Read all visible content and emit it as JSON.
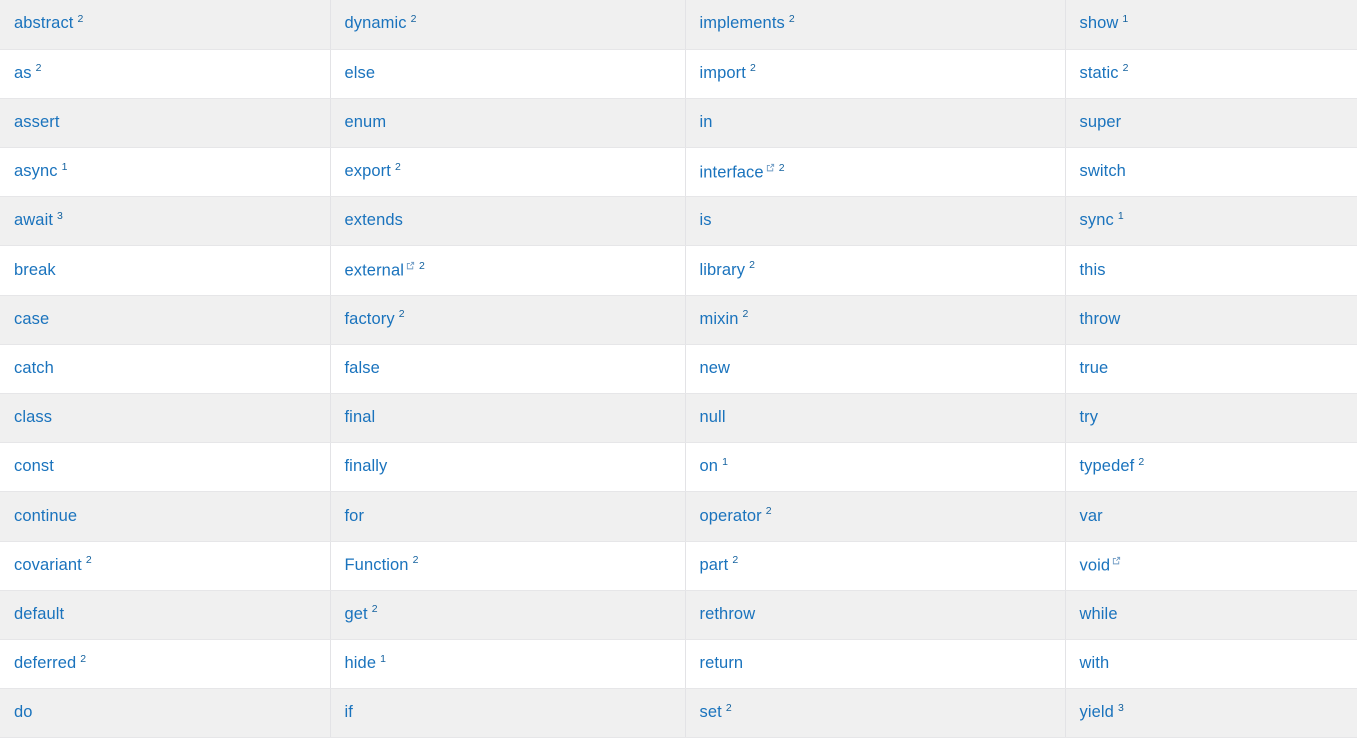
{
  "page": {
    "title": "Dart language keywords",
    "link_color": "#1a73bd",
    "footnote_color": "#14629f",
    "row_stripe_color": "#f0f0f0",
    "row_base_color": "#ffffff",
    "border_color": "#e3e3e6"
  },
  "table": {
    "column_count": 4,
    "row_count": 15,
    "rows": [
      [
        {
          "label": "abstract",
          "footnote": "2",
          "external": false
        },
        {
          "label": "dynamic",
          "footnote": "2",
          "external": false
        },
        {
          "label": "implements",
          "footnote": "2",
          "external": false
        },
        {
          "label": "show",
          "footnote": "1",
          "external": false
        }
      ],
      [
        {
          "label": "as",
          "footnote": "2",
          "external": false
        },
        {
          "label": "else",
          "footnote": "",
          "external": false
        },
        {
          "label": "import",
          "footnote": "2",
          "external": false
        },
        {
          "label": "static",
          "footnote": "2",
          "external": false
        }
      ],
      [
        {
          "label": "assert",
          "footnote": "",
          "external": false
        },
        {
          "label": "enum",
          "footnote": "",
          "external": false
        },
        {
          "label": "in",
          "footnote": "",
          "external": false
        },
        {
          "label": "super",
          "footnote": "",
          "external": false
        }
      ],
      [
        {
          "label": "async",
          "footnote": "1",
          "external": false
        },
        {
          "label": "export",
          "footnote": "2",
          "external": false
        },
        {
          "label": "interface",
          "footnote": "2",
          "external": true
        },
        {
          "label": "switch",
          "footnote": "",
          "external": false
        }
      ],
      [
        {
          "label": "await",
          "footnote": "3",
          "external": false
        },
        {
          "label": "extends",
          "footnote": "",
          "external": false
        },
        {
          "label": "is",
          "footnote": "",
          "external": false
        },
        {
          "label": "sync",
          "footnote": "1",
          "external": false
        }
      ],
      [
        {
          "label": "break",
          "footnote": "",
          "external": false
        },
        {
          "label": "external",
          "footnote": "2",
          "external": true
        },
        {
          "label": "library",
          "footnote": "2",
          "external": false
        },
        {
          "label": "this",
          "footnote": "",
          "external": false
        }
      ],
      [
        {
          "label": "case",
          "footnote": "",
          "external": false
        },
        {
          "label": "factory",
          "footnote": "2",
          "external": false
        },
        {
          "label": "mixin",
          "footnote": "2",
          "external": false
        },
        {
          "label": "throw",
          "footnote": "",
          "external": false
        }
      ],
      [
        {
          "label": "catch",
          "footnote": "",
          "external": false
        },
        {
          "label": "false",
          "footnote": "",
          "external": false
        },
        {
          "label": "new",
          "footnote": "",
          "external": false
        },
        {
          "label": "true",
          "footnote": "",
          "external": false
        }
      ],
      [
        {
          "label": "class",
          "footnote": "",
          "external": false
        },
        {
          "label": "final",
          "footnote": "",
          "external": false
        },
        {
          "label": "null",
          "footnote": "",
          "external": false
        },
        {
          "label": "try",
          "footnote": "",
          "external": false
        }
      ],
      [
        {
          "label": "const",
          "footnote": "",
          "external": false
        },
        {
          "label": "finally",
          "footnote": "",
          "external": false
        },
        {
          "label": "on",
          "footnote": "1",
          "external": false
        },
        {
          "label": "typedef",
          "footnote": "2",
          "external": false
        }
      ],
      [
        {
          "label": "continue",
          "footnote": "",
          "external": false
        },
        {
          "label": "for",
          "footnote": "",
          "external": false
        },
        {
          "label": "operator",
          "footnote": "2",
          "external": false
        },
        {
          "label": "var",
          "footnote": "",
          "external": false
        }
      ],
      [
        {
          "label": "covariant",
          "footnote": "2",
          "external": false
        },
        {
          "label": "Function",
          "footnote": "2",
          "external": false
        },
        {
          "label": "part",
          "footnote": "2",
          "external": false
        },
        {
          "label": "void",
          "footnote": "",
          "external": true
        }
      ],
      [
        {
          "label": "default",
          "footnote": "",
          "external": false
        },
        {
          "label": "get",
          "footnote": "2",
          "external": false
        },
        {
          "label": "rethrow",
          "footnote": "",
          "external": false
        },
        {
          "label": "while",
          "footnote": "",
          "external": false
        }
      ],
      [
        {
          "label": "deferred",
          "footnote": "2",
          "external": false
        },
        {
          "label": "hide",
          "footnote": "1",
          "external": false
        },
        {
          "label": "return",
          "footnote": "",
          "external": false
        },
        {
          "label": "with",
          "footnote": "",
          "external": false
        }
      ],
      [
        {
          "label": "do",
          "footnote": "",
          "external": false
        },
        {
          "label": "if",
          "footnote": "",
          "external": false
        },
        {
          "label": "set",
          "footnote": "2",
          "external": false
        },
        {
          "label": "yield",
          "footnote": "3",
          "external": false
        }
      ]
    ]
  },
  "icons": {
    "external_link": "external-link-icon"
  }
}
